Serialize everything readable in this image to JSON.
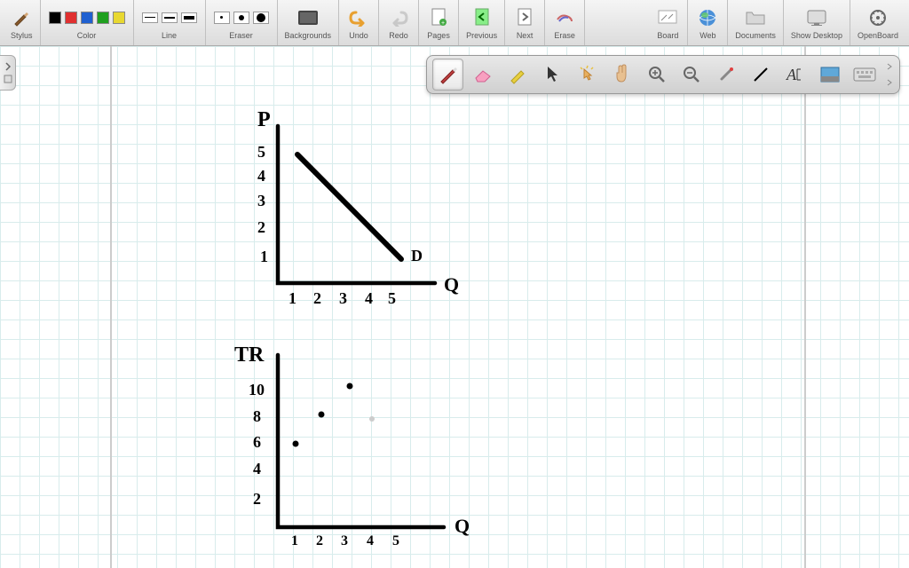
{
  "toolbar": {
    "stylus": "Stylus",
    "color": "Color",
    "line": "Line",
    "eraser": "Eraser",
    "backgrounds": "Backgrounds",
    "undo": "Undo",
    "redo": "Redo",
    "pages": "Pages",
    "previous": "Previous",
    "next": "Next",
    "erase": "Erase",
    "board": "Board",
    "web": "Web",
    "documents": "Documents",
    "show_desktop": "Show Desktop",
    "openboard": "OpenBoard"
  },
  "colors": [
    "#000000",
    "#e03030",
    "#2060d0",
    "#20a020",
    "#e8d830"
  ],
  "chart_data": [
    {
      "type": "line",
      "title": "",
      "xlabel": "Q",
      "ylabel": "P",
      "x_ticks": [
        "1",
        "2",
        "3",
        "4",
        "5"
      ],
      "y_ticks": [
        "1",
        "2",
        "3",
        "4",
        "5"
      ],
      "series": [
        {
          "name": "D",
          "x": [
            1,
            5
          ],
          "y": [
            5,
            1
          ]
        }
      ],
      "xlim": [
        0,
        6
      ],
      "ylim": [
        0,
        6
      ]
    },
    {
      "type": "scatter",
      "title": "",
      "xlabel": "Q",
      "ylabel": "TR",
      "x_ticks": [
        "1",
        "2",
        "3",
        "4",
        "5"
      ],
      "y_ticks": [
        "2",
        "4",
        "6",
        "8",
        "10"
      ],
      "series": [
        {
          "name": "",
          "x": [
            1,
            2,
            3
          ],
          "y": [
            6,
            8,
            10
          ]
        }
      ],
      "xlim": [
        0,
        6
      ],
      "ylim": [
        0,
        12
      ]
    }
  ]
}
